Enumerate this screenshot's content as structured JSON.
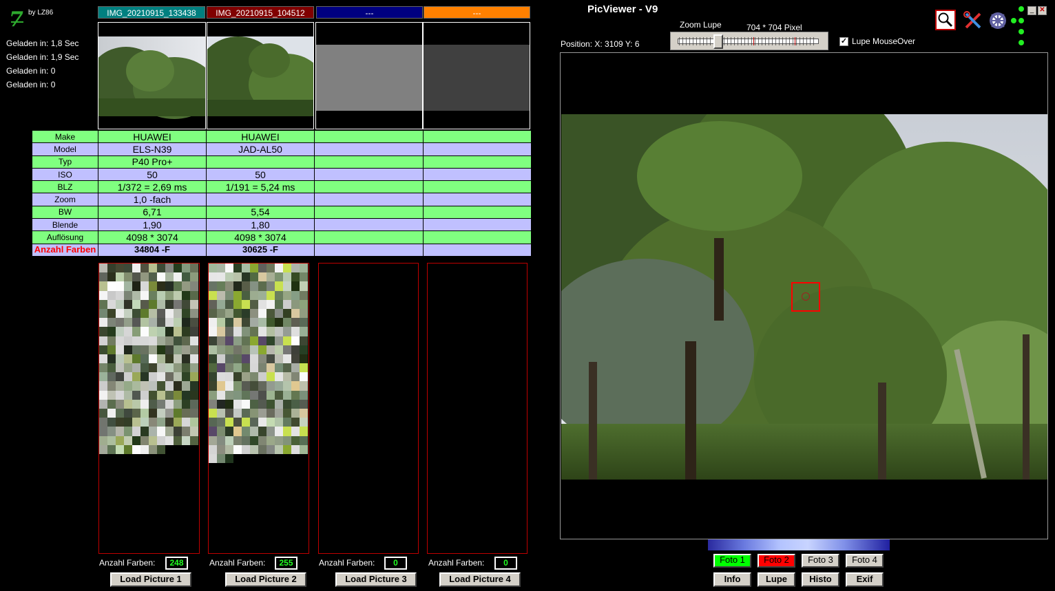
{
  "header": {
    "logo_byline": "by LZ86",
    "load_times": [
      "Geladen in: 1,8 Sec",
      "Geladen in: 1,9 Sec",
      "Geladen in: 0",
      "Geladen in: 0"
    ]
  },
  "slots": [
    {
      "title": "IMG_20210915_133438",
      "title_color": "#008080",
      "count": "248",
      "load_label": "Load Picture 1"
    },
    {
      "title": "IMG_20210915_104512",
      "title_color": "#800000",
      "count": "255",
      "load_label": "Load Picture 2"
    },
    {
      "title": "---",
      "title_color": "#000080",
      "count": "0",
      "load_label": "Load Picture 3"
    },
    {
      "title": "---",
      "title_color": "#ff8000",
      "count": "0",
      "load_label": "Load Picture 4"
    }
  ],
  "count_label": "Anzahl Farben:",
  "exif_rows": [
    {
      "label": "Make",
      "values": [
        "HUAWEI",
        "HUAWEI",
        "",
        ""
      ]
    },
    {
      "label": "Model",
      "values": [
        "ELS-N39",
        "JAD-AL50",
        "",
        ""
      ]
    },
    {
      "label": "Typ",
      "values": [
        "P40 Pro+",
        "",
        "",
        ""
      ]
    },
    {
      "label": "ISO",
      "values": [
        "50",
        "50",
        "",
        ""
      ]
    },
    {
      "label": "BLZ",
      "values": [
        "1/372 = 2,69 ms",
        "1/191 = 5,24 ms",
        "",
        ""
      ]
    },
    {
      "label": "Zoom",
      "values": [
        "1,0 -fach",
        "",
        "",
        ""
      ]
    },
    {
      "label": "BW",
      "values": [
        "6,71",
        "5,54",
        "",
        ""
      ]
    },
    {
      "label": "Blende",
      "values": [
        "1,90",
        "1,80",
        "",
        ""
      ]
    },
    {
      "label": "Auflösung",
      "values": [
        "4098 * 3074",
        "4098 * 3074",
        "",
        ""
      ]
    },
    {
      "label": "Anzahl Farben",
      "values": [
        "34804 -F",
        "30625 -F",
        "",
        ""
      ]
    }
  ],
  "viewer": {
    "title": "PicViewer - V9",
    "zoom_label": "Zoom Lupe",
    "pixel_label": "704 * 704 Pixel",
    "position": "Position: X: 3109 Y: 6",
    "lupe_mouseover_label": "Lupe MouseOver",
    "lupe_mouseover_checked": true,
    "zoom_slider_value": 0.28
  },
  "colors": {
    "accent_green": "#80ff80",
    "accent_lavender": "#c0c0ff",
    "active_foto1": "#00ff00",
    "active_foto2": "#ff0000"
  },
  "foto_buttons": [
    "Foto 1",
    "Foto 2",
    "Foto 3",
    "Foto 4"
  ],
  "bottom_buttons": [
    "Info",
    "Lupe",
    "Histo",
    "Exif"
  ],
  "icons": [
    "magnifier-icon",
    "tools-icon",
    "settings-gear-icon",
    "minimize-icon",
    "close-icon"
  ]
}
